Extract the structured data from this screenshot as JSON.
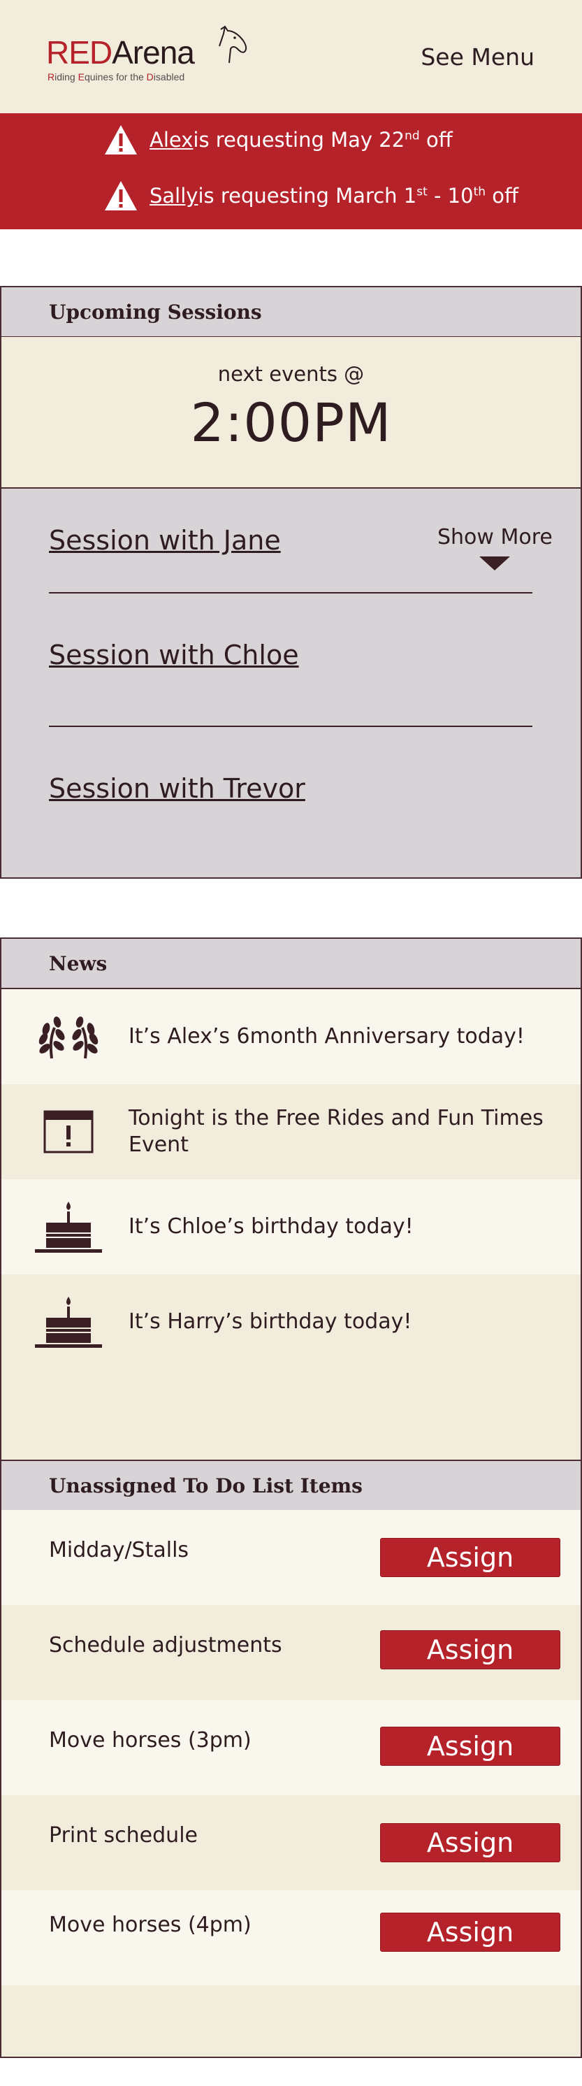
{
  "header": {
    "logo_red": "RED",
    "logo_dark": "Arena",
    "logo_tagline": [
      "R",
      "iding ",
      "E",
      "quines for the ",
      "D",
      "isabled"
    ],
    "menu_label": "See Menu"
  },
  "alerts": [
    {
      "name": "Alex ",
      "text_before": "is requesting May 22",
      "sup": "nd",
      "text_after": " off"
    },
    {
      "name": "Sally ",
      "text_before": "is requesting March 1",
      "sup": "st",
      "text_mid": " - 10",
      "sup2": "th",
      "text_after": " off"
    }
  ],
  "upcoming": {
    "title": "Upcoming Sessions",
    "next_label": "next events @",
    "next_time": "2:00PM",
    "show_more": "Show More",
    "sessions": [
      "Session with Jane",
      "Session with Chloe",
      "Session with Trevor"
    ]
  },
  "news": {
    "title": "News",
    "items": [
      {
        "icon": "laurel-icon",
        "text": "It’s Alex’s 6month Anniversary today!"
      },
      {
        "icon": "calendar-alert-icon",
        "text": "Tonight is the Free Rides and Fun Times Event"
      },
      {
        "icon": "birthday-cake-icon",
        "text": "It’s Chloe’s birthday today!"
      },
      {
        "icon": "birthday-cake-icon",
        "text": "It’s Harry’s birthday today!"
      }
    ]
  },
  "todo": {
    "title": "Unassigned To Do List Items",
    "assign_label": "Assign",
    "items": [
      "Midday/Stalls",
      "Schedule adjustments",
      "Move horses (3pm)",
      "Print schedule",
      "Move horses (4pm)"
    ]
  },
  "colors": {
    "brand_red": "#b5222a",
    "cream": "#f2ecdc",
    "panel_gray": "#d8d3d6",
    "dark": "#2e1c21"
  }
}
